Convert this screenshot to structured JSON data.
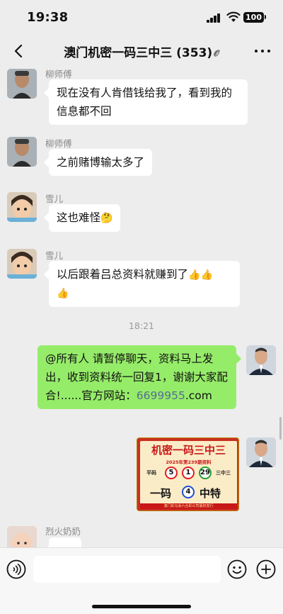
{
  "status_bar": {
    "time": "19:38",
    "battery": "100"
  },
  "nav": {
    "title": "澳门机密一码三中三 (353)"
  },
  "messages": [
    {
      "sender": "柳师傅",
      "text": "现在没有人肯借钱给我了，看到我的信息都不回"
    },
    {
      "sender": "柳师傅",
      "text": "之前赌博输太多了"
    },
    {
      "sender": "雪儿",
      "text": "这也难怪"
    },
    {
      "sender": "雪儿",
      "text": "以后跟着吕总资料就赚到了"
    },
    {
      "timestamp": "18:21"
    },
    {
      "sender": "me",
      "text_prefix": "@所有人 请暂停聊天，资料马上发出，收到资料统一回复1，谢谢大家配合!......官方网站：",
      "link": "6699955",
      "link_suffix": ".com"
    },
    {
      "sender": "me",
      "image": "lottery-card"
    },
    {
      "sender": "烈火奶奶"
    }
  ],
  "lottery_card": {
    "title": "机密一码三中三",
    "subtitle": "2025年第239期资料",
    "left_label": "平码",
    "right_label": "三中三",
    "balls": [
      "5",
      "1",
      "29"
    ],
    "yima_left": "一码",
    "special_ball": "4",
    "yima_right": "中特",
    "footer": "澳门彩马会六合彩公司版权发行"
  },
  "colors": {
    "self_bubble": "#95ec69",
    "link": "#576b95",
    "background": "#ededed"
  }
}
